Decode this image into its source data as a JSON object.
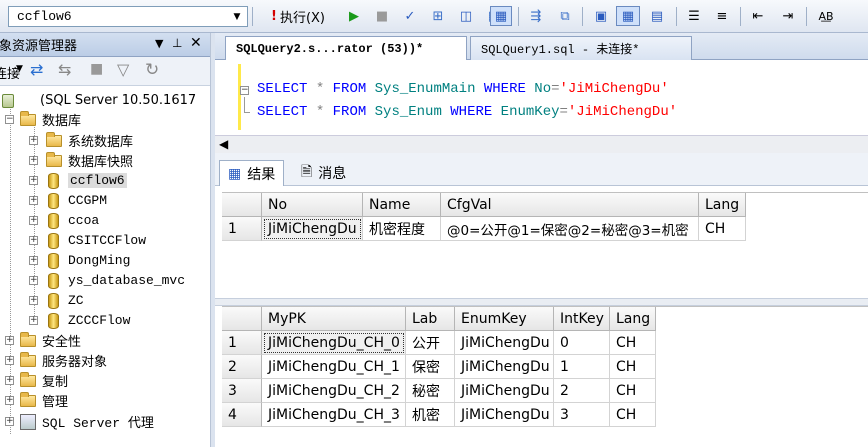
{
  "toolbar": {
    "database": "ccflow6",
    "execute_label": "执行(X)"
  },
  "object_explorer": {
    "title": "对象资源管理器",
    "connect_label": "连接",
    "server": "(SQL Server 10.50.1617",
    "tree": {
      "databases": "数据库",
      "system_databases": "系统数据库",
      "snapshots": "数据库快照",
      "db_list": [
        "ccflow6",
        "CCGPM",
        "ccoa",
        "CSITCCFlow",
        "DongMing",
        "ys_database_mvc",
        "ZC",
        "ZCCCFlow"
      ],
      "security": "安全性",
      "server_objects": "服务器对象",
      "replication": "复制",
      "management": "管理",
      "agent": "SQL Server 代理"
    }
  },
  "editor": {
    "tabs": [
      {
        "label": "SQLQuery2.s...rator (53))*"
      },
      {
        "label": "SQLQuery1.sql - 未连接*"
      }
    ],
    "line1": {
      "k1": "SELECT",
      "op": " * ",
      "k2": "FROM",
      "obj": " Sys_EnumMain ",
      "k3": "WHERE",
      "col": " No",
      "eq": "=",
      "str": "'JiMiChengDu'"
    },
    "line2": {
      "k1": "SELECT",
      "op": " * ",
      "k2": "FROM",
      "obj": " Sys_Enum ",
      "k3": "WHERE",
      "col": " EnumKey",
      "eq": "=",
      "str": "'JiMiChengDu'"
    }
  },
  "results": {
    "tab_results": "结果",
    "tab_messages": "消息",
    "grid1": {
      "columns": [
        "No",
        "Name",
        "CfgVal",
        "Lang"
      ],
      "rows": [
        [
          "1",
          "JiMiChengDu",
          "机密程度",
          "@0=公开@1=保密@2=秘密@3=机密",
          "CH"
        ]
      ]
    },
    "grid2": {
      "columns": [
        "MyPK",
        "Lab",
        "EnumKey",
        "IntKey",
        "Lang"
      ],
      "rows": [
        [
          "1",
          "JiMiChengDu_CH_0",
          "公开",
          "JiMiChengDu",
          "0",
          "CH"
        ],
        [
          "2",
          "JiMiChengDu_CH_1",
          "保密",
          "JiMiChengDu",
          "1",
          "CH"
        ],
        [
          "3",
          "JiMiChengDu_CH_2",
          "秘密",
          "JiMiChengDu",
          "2",
          "CH"
        ],
        [
          "4",
          "JiMiChengDu_CH_3",
          "机密",
          "JiMiChengDu",
          "3",
          "CH"
        ]
      ]
    }
  }
}
